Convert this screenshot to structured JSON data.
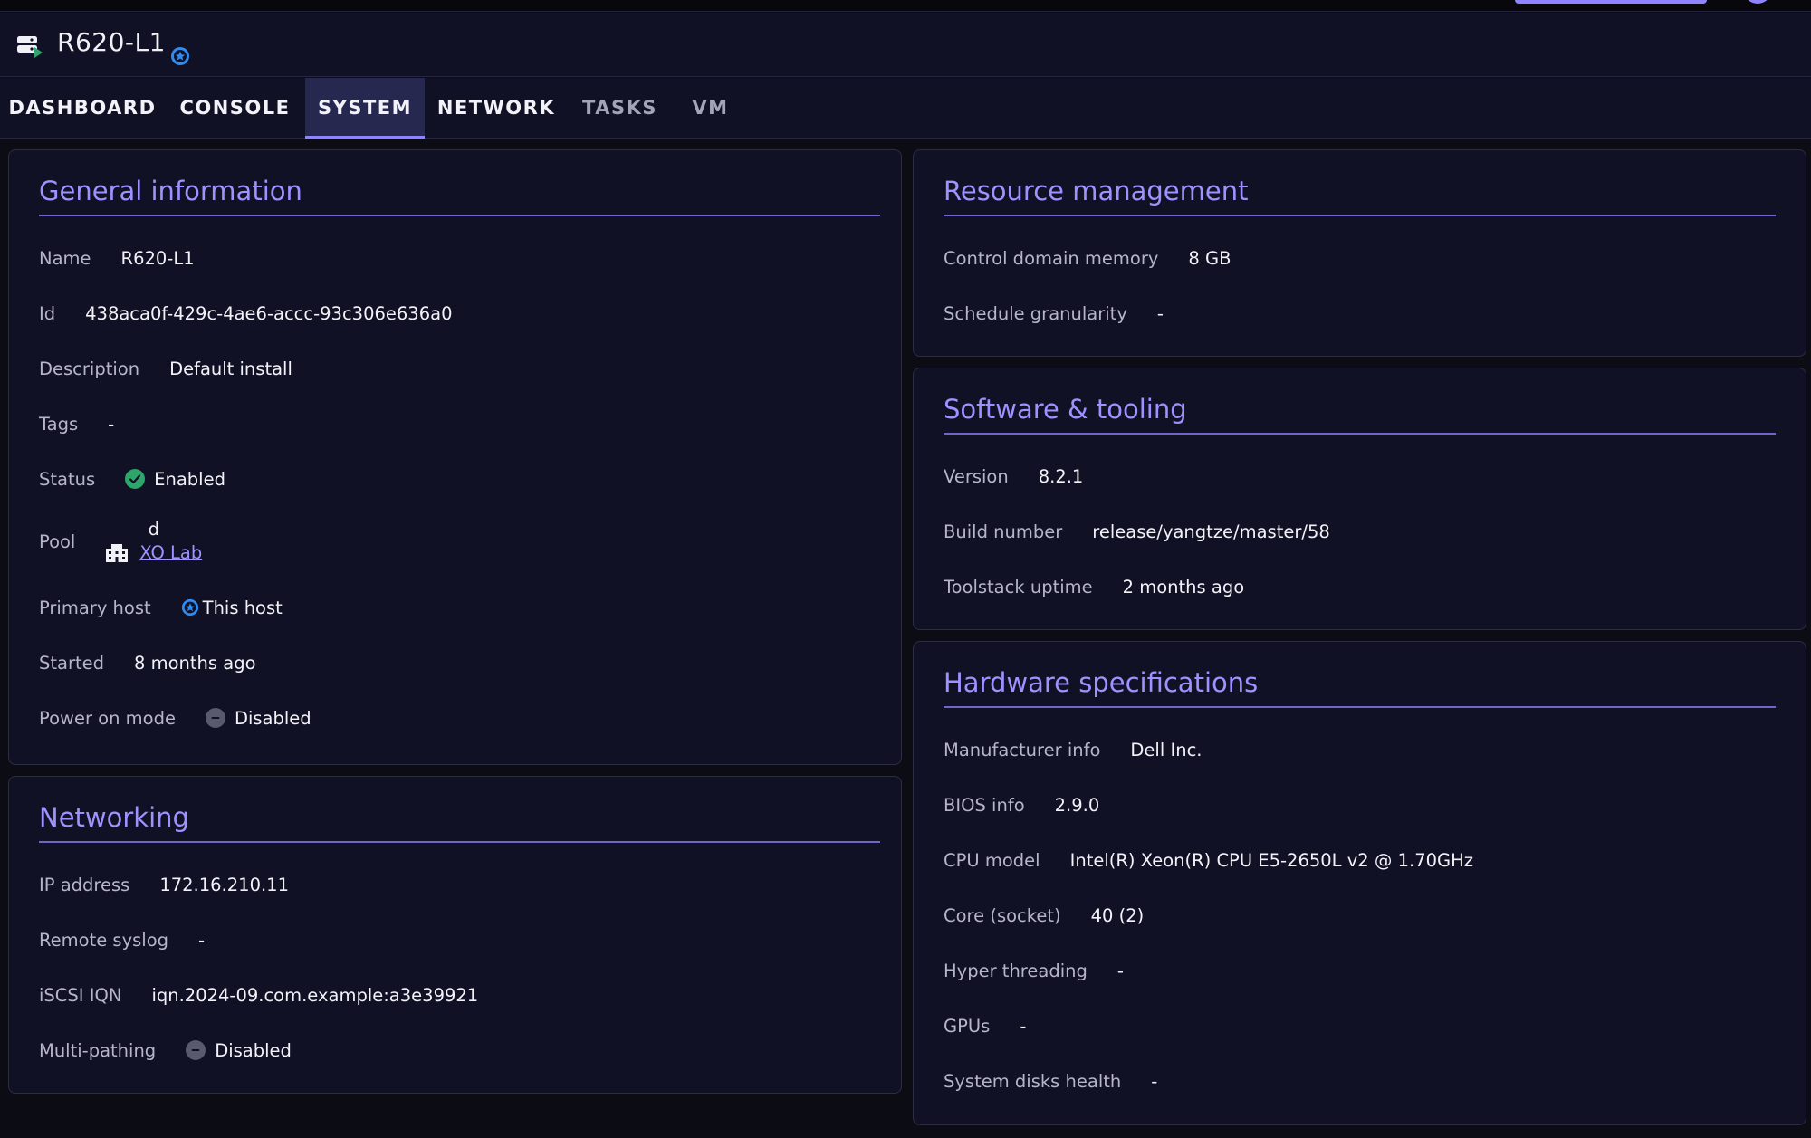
{
  "host": {
    "name": "R620-L1"
  },
  "tabs": [
    {
      "label": "DASHBOARD"
    },
    {
      "label": "CONSOLE"
    },
    {
      "label": "SYSTEM"
    },
    {
      "label": "NETWORK"
    },
    {
      "label": "TASKS"
    },
    {
      "label": "VM"
    }
  ],
  "general": {
    "title": "General information",
    "name_label": "Name",
    "name_value": "R620-L1",
    "id_label": "Id",
    "id_value": "438aca0f-429c-4ae6-accc-93c306e636a0",
    "description_label": "Description",
    "description_value": "Default install",
    "tags_label": "Tags",
    "tags_value": "-",
    "status_label": "Status",
    "status_value": "Enabled",
    "pool_label": "Pool",
    "pool_prefix": "d",
    "pool_value": "XO Lab",
    "primary_host_label": "Primary host",
    "primary_host_value": "This host",
    "started_label": "Started",
    "started_value": "8 months ago",
    "power_on_label": "Power on mode",
    "power_on_value": "Disabled"
  },
  "networking": {
    "title": "Networking",
    "ip_label": "IP address",
    "ip_value": "172.16.210.11",
    "syslog_label": "Remote syslog",
    "syslog_value": "-",
    "iqn_label": "iSCSI IQN",
    "iqn_value": "iqn.2024-09.com.example:a3e39921",
    "multipath_label": "Multi-pathing",
    "multipath_value": "Disabled"
  },
  "resource": {
    "title": "Resource management",
    "memory_label": "Control domain memory",
    "memory_value": "8 GB",
    "sched_label": "Schedule granularity",
    "sched_value": "-"
  },
  "software": {
    "title": "Software & tooling",
    "version_label": "Version",
    "version_value": "8.2.1",
    "build_label": "Build number",
    "build_value": "release/yangtze/master/58",
    "uptime_label": "Toolstack uptime",
    "uptime_value": "2 months ago"
  },
  "hardware": {
    "title": "Hardware specifications",
    "manufacturer_label": "Manufacturer info",
    "manufacturer_value": "Dell Inc.",
    "bios_label": "BIOS info",
    "bios_value": "2.9.0",
    "cpu_label": "CPU model",
    "cpu_value": "Intel(R) Xeon(R) CPU E5-2650L v2 @ 1.70GHz",
    "core_label": "Core (socket)",
    "core_value": "40 (2)",
    "ht_label": "Hyper threading",
    "ht_value": "-",
    "gpu_label": "GPUs",
    "gpu_value": "-",
    "disks_label": "System disks health",
    "disks_value": "-"
  },
  "colors": {
    "accent": "#9d92ff",
    "background": "#0c0c14",
    "card": "#111125",
    "status_enabled": "#2ca66a",
    "status_disabled": "#5a5a6e",
    "primary_star": "#2f8cf0"
  },
  "icons": {
    "host": "server-icon",
    "primary": "star-badge-icon",
    "status_enabled": "check-circle-icon",
    "status_disabled": "minus-circle-icon",
    "pool": "building-icon"
  }
}
